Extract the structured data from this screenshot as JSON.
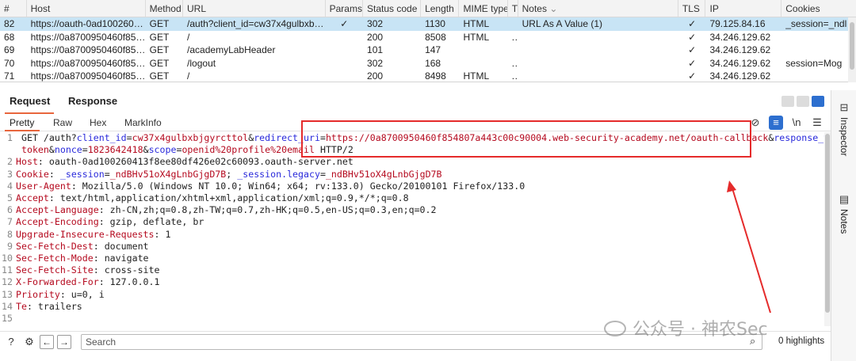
{
  "history": {
    "headers": [
      "#",
      "Host",
      "Method",
      "URL",
      "Params",
      "Status code",
      "Length",
      "MIME type",
      "Ti",
      "Notes",
      "TLS",
      "IP",
      "Cookies"
    ],
    "rows": [
      {
        "num": "82",
        "host": "https://oauth-0ad100260413...",
        "method": "GET",
        "url": "/auth?client_id=cw37x4gulbxbjgyr...",
        "params": "✓",
        "status": "302",
        "length": "1130",
        "mime": "HTML",
        "ti": "",
        "notes": "URL As A Value (1)",
        "tls": "✓",
        "ip": "79.125.84.16",
        "cookies": "_session=_ndl",
        "selected": true
      },
      {
        "num": "68",
        "host": "https://0a8700950460f85480...",
        "method": "GET",
        "url": "/",
        "params": "",
        "status": "200",
        "length": "8508",
        "mime": "HTML",
        "ti": "...",
        "notes": "",
        "tls": "✓",
        "ip": "34.246.129.62",
        "cookies": "",
        "selected": false
      },
      {
        "num": "69",
        "host": "https://0a8700950460f85480...",
        "method": "GET",
        "url": "/academyLabHeader",
        "params": "",
        "status": "101",
        "length": "147",
        "mime": "",
        "ti": "",
        "notes": "",
        "tls": "✓",
        "ip": "34.246.129.62",
        "cookies": "",
        "selected": false
      },
      {
        "num": "70",
        "host": "https://0a8700950460f85480...",
        "method": "GET",
        "url": "/logout",
        "params": "",
        "status": "302",
        "length": "168",
        "mime": "",
        "ti": "...",
        "notes": "",
        "tls": "✓",
        "ip": "34.246.129.62",
        "cookies": "session=Mog",
        "selected": false
      },
      {
        "num": "71",
        "host": "https://0a8700950460f85480...",
        "method": "GET",
        "url": "/",
        "params": "",
        "status": "200",
        "length": "8498",
        "mime": "HTML",
        "ti": "...",
        "notes": "",
        "tls": "✓",
        "ip": "34.246.129.62",
        "cookies": "",
        "selected": false
      }
    ]
  },
  "tabs": {
    "request": "Request",
    "response": "Response"
  },
  "subtabs": {
    "pretty": "Pretty",
    "raw": "Raw",
    "hex": "Hex",
    "markinfo": "MarkInfo"
  },
  "tools": {
    "newline": "\\n"
  },
  "editor": {
    "l1_a": "GET /auth?",
    "l1_p1": "client_id",
    "l1_v1": "cw37x4gulbxbjgyrcttol",
    "l1_p2": "redirect_uri",
    "l1_v2": "https://0a8700950460f854807a443c00c90004.web-security-academy.net/oauth-callback",
    "l1_p3": "response_type",
    "l2_v3": "token",
    "l2_p4": "nonce",
    "l2_v4": "1823642418",
    "l2_p5": "scope",
    "l2_v5": "openid%20profile%20email",
    "l2_tail": " HTTP/2",
    "headers": [
      {
        "name": "Host",
        "value": " oauth-0ad100260413f8ee80df426e02c60093.oauth-server.net"
      },
      {
        "name": "Cookie",
        "value": ""
      },
      {
        "name": "User-Agent",
        "value": " Mozilla/5.0 (Windows NT 10.0; Win64; x64; rv:133.0) Gecko/20100101 Firefox/133.0"
      },
      {
        "name": "Accept",
        "value": " text/html,application/xhtml+xml,application/xml;q=0.9,*/*;q=0.8"
      },
      {
        "name": "Accept-Language",
        "value": " zh-CN,zh;q=0.8,zh-TW;q=0.7,zh-HK;q=0.5,en-US;q=0.3,en;q=0.2"
      },
      {
        "name": "Accept-Encoding",
        "value": " gzip, deflate, br"
      },
      {
        "name": "Upgrade-Insecure-Requests",
        "value": " 1"
      },
      {
        "name": "Sec-Fetch-Dest",
        "value": " document"
      },
      {
        "name": "Sec-Fetch-Mode",
        "value": " navigate"
      },
      {
        "name": "Sec-Fetch-Site",
        "value": " cross-site"
      },
      {
        "name": "X-Forwarded-For",
        "value": " 127.0.0.1"
      },
      {
        "name": "Priority",
        "value": " u=0, i"
      },
      {
        "name": "Te",
        "value": " trailers"
      }
    ],
    "cookie_p1": "_session",
    "cookie_v1": "_ndBHv51oX4gLnbGjgD7B",
    "cookie_p2": "_session.legacy",
    "cookie_v2": "_ndBHv51oX4gLnbGjgD7B",
    "line_numbers": [
      "1",
      "",
      "2",
      "3",
      "4",
      "5",
      "6",
      "7",
      "8",
      "9",
      "10",
      "11",
      "12",
      "13",
      "14",
      "15"
    ]
  },
  "side_panel": {
    "inspector": "Inspector",
    "notes": "Notes"
  },
  "search": {
    "placeholder": "Search",
    "highlights": "0 highlights"
  },
  "watermark": "公众号 · 神农Sec",
  "colors": {
    "accent": "#e8663d",
    "selected_row": "#c8e4f5",
    "annotation": "#e52b2b",
    "param_name": "#2a2adb",
    "param_value": "#b50a1f"
  }
}
